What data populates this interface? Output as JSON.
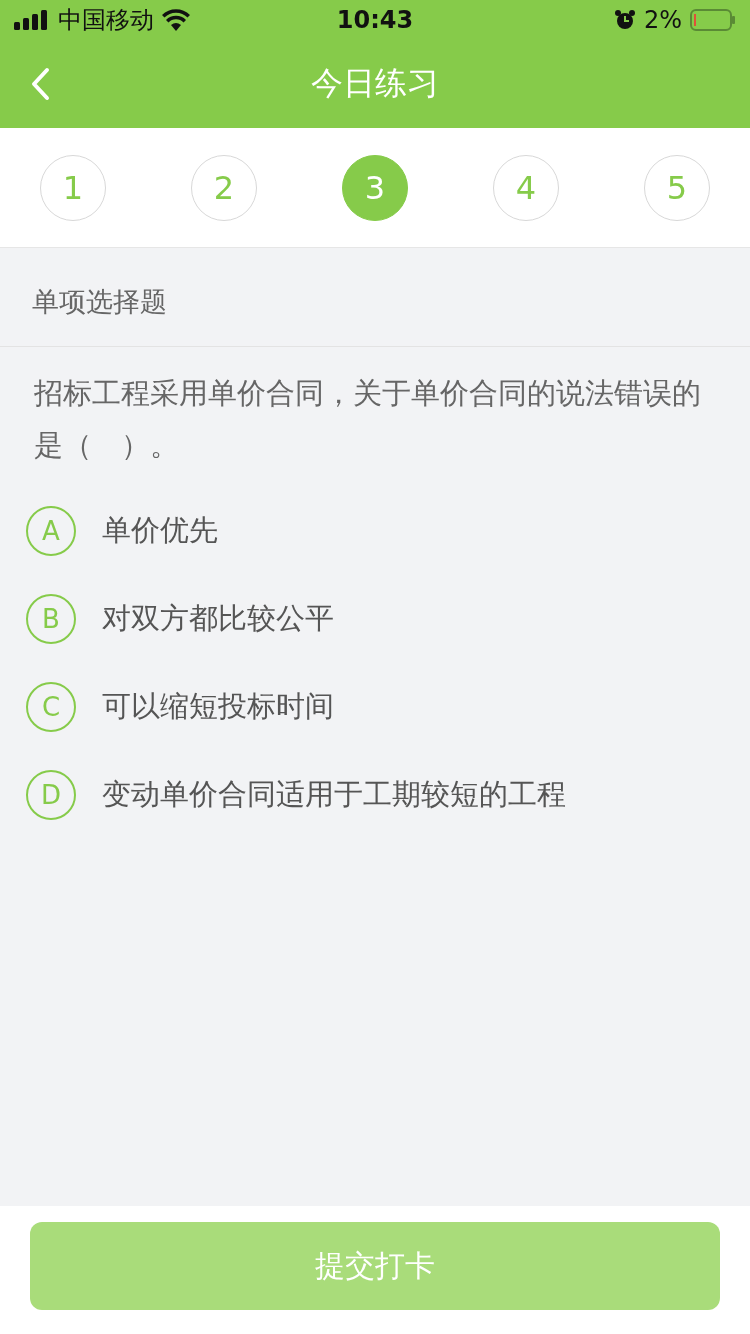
{
  "status_bar": {
    "carrier": "中国移动",
    "time": "10:43",
    "battery": "2%"
  },
  "nav": {
    "title": "今日练习"
  },
  "steps": [
    {
      "label": "1",
      "selected": false
    },
    {
      "label": "2",
      "selected": false
    },
    {
      "label": "3",
      "selected": true
    },
    {
      "label": "4",
      "selected": false
    },
    {
      "label": "5",
      "selected": false
    }
  ],
  "question_type": "单项选择题",
  "question": "招标工程采用单价合同，关于单价合同的说法错误的是（　）。",
  "options": [
    {
      "letter": "A",
      "text": "单价优先",
      "selected": false
    },
    {
      "letter": "B",
      "text": "对双方都比较公平",
      "selected": false
    },
    {
      "letter": "C",
      "text": "可以缩短投标时间",
      "selected": false
    },
    {
      "letter": "D",
      "text": "变动单价合同适用于工期较短的工程",
      "selected": false
    }
  ],
  "submit": {
    "label": "提交打卡",
    "disabled": true
  }
}
